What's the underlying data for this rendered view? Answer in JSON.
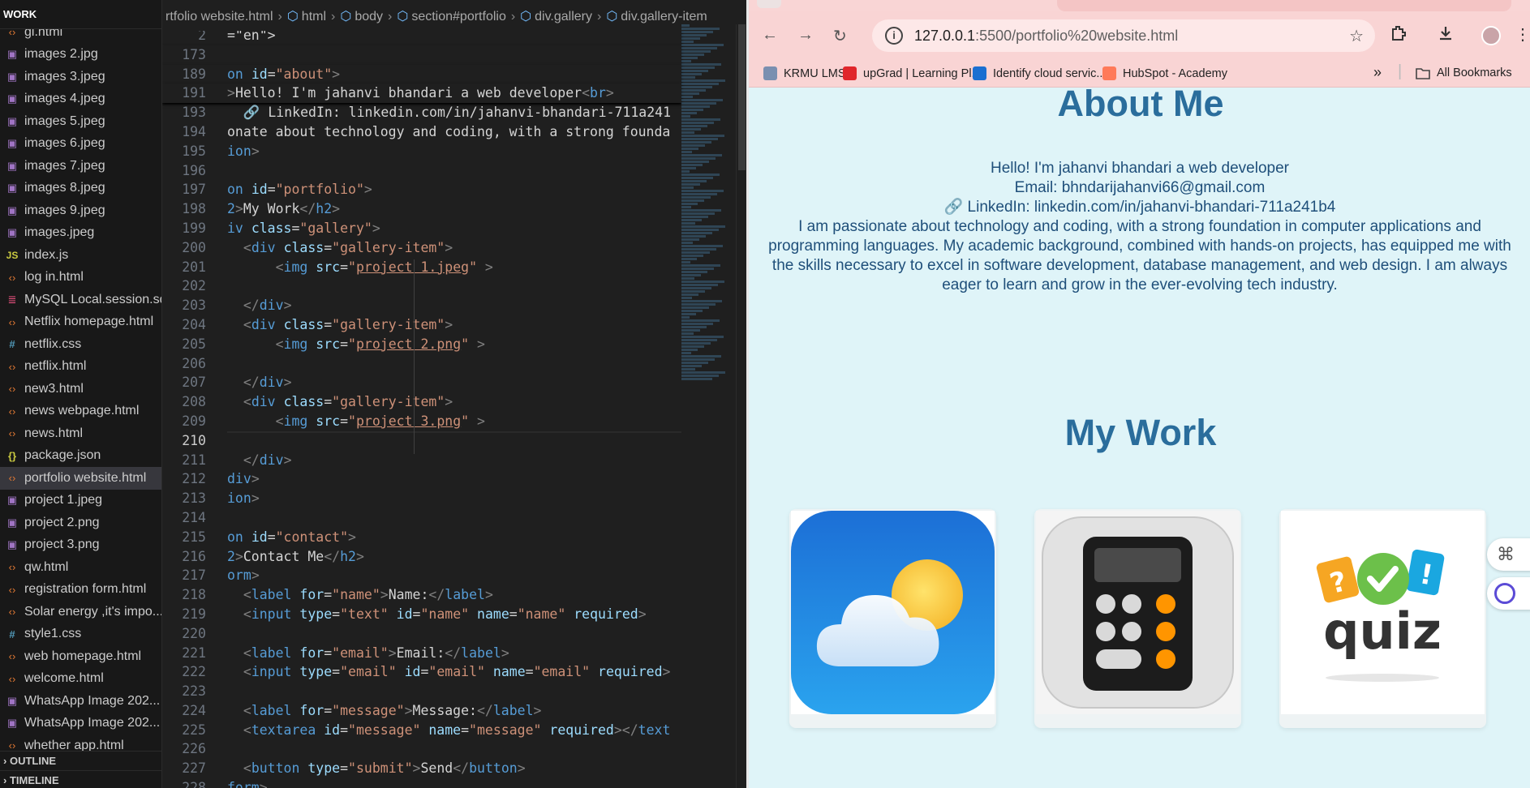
{
  "explorer": {
    "header": "WORK",
    "items": [
      {
        "name": "gi.html",
        "type": "html"
      },
      {
        "name": "images 2.jpg",
        "type": "img"
      },
      {
        "name": "images 3.jpeg",
        "type": "img"
      },
      {
        "name": "images 4.jpeg",
        "type": "img"
      },
      {
        "name": "images 5.jpeg",
        "type": "img"
      },
      {
        "name": "images 6.jpeg",
        "type": "img"
      },
      {
        "name": "images 7.jpeg",
        "type": "img"
      },
      {
        "name": "images 8.jpeg",
        "type": "img"
      },
      {
        "name": "images 9.jpeg",
        "type": "img"
      },
      {
        "name": "images.jpeg",
        "type": "img"
      },
      {
        "name": "index.js",
        "type": "js"
      },
      {
        "name": "log in.html",
        "type": "html"
      },
      {
        "name": "MySQL Local.session.sql",
        "type": "sql"
      },
      {
        "name": "Netflix homepage.html",
        "type": "html"
      },
      {
        "name": "netflix.css",
        "type": "css"
      },
      {
        "name": "netflix.html",
        "type": "html"
      },
      {
        "name": "new3.html",
        "type": "html"
      },
      {
        "name": "news webpage.html",
        "type": "html"
      },
      {
        "name": "news.html",
        "type": "html"
      },
      {
        "name": "package.json",
        "type": "json"
      },
      {
        "name": "portfolio website.html",
        "type": "html",
        "active": true
      },
      {
        "name": "project 1.jpeg",
        "type": "img"
      },
      {
        "name": "project 2.png",
        "type": "img"
      },
      {
        "name": "project 3.png",
        "type": "img"
      },
      {
        "name": "qw.html",
        "type": "html"
      },
      {
        "name": "registration form.html",
        "type": "html"
      },
      {
        "name": "Solar energy ,it's impo...",
        "type": "html"
      },
      {
        "name": "style1.css",
        "type": "css"
      },
      {
        "name": "web homepage.html",
        "type": "html"
      },
      {
        "name": "welcome.html",
        "type": "html"
      },
      {
        "name": "WhatsApp Image 202...",
        "type": "img"
      },
      {
        "name": "WhatsApp Image 202...",
        "type": "img"
      },
      {
        "name": "whether app.html",
        "type": "html"
      }
    ],
    "outline": "OUTLINE",
    "timeline": "TIMELINE"
  },
  "editor": {
    "breadcrumbs": [
      "rtfolio website.html",
      "html",
      "body",
      "section#portfolio",
      "div.gallery",
      "div.gallery-item"
    ],
    "current_line": "210",
    "lines": [
      {
        "n": "2",
        "sticky": true,
        "tokens": [
          [
            "t-txt",
            "=\"en\">"
          ]
        ]
      },
      {
        "n": "173",
        "sticky": true,
        "tokens": []
      },
      {
        "n": "189",
        "sticky": true,
        "tokens": [
          [
            "t-tag",
            "on "
          ],
          [
            "t-attr",
            "id"
          ],
          [
            "t-txt",
            "="
          ],
          [
            "t-str",
            "\"about\""
          ],
          [
            "t-p",
            ">"
          ]
        ]
      },
      {
        "n": "191",
        "sticky": true,
        "tokens": [
          [
            "t-p",
            ">"
          ],
          [
            "t-txt",
            "Hello! I'm jahanvi bhandari a web developer"
          ],
          [
            "t-p",
            "<"
          ],
          [
            "t-tag",
            "br"
          ],
          [
            "t-p",
            ">"
          ]
        ]
      },
      {
        "n": "193",
        "tokens": [
          [
            "t-txt",
            "  🔗 LinkedIn: linkedin.com/in/jahanvi-bhandari-711a241"
          ]
        ]
      },
      {
        "n": "194",
        "tokens": [
          [
            "t-txt",
            "onate about technology and coding, with a strong founda"
          ]
        ]
      },
      {
        "n": "195",
        "tokens": [
          [
            "t-tag",
            "ion"
          ],
          [
            "t-p",
            ">"
          ]
        ]
      },
      {
        "n": "196",
        "tokens": []
      },
      {
        "n": "197",
        "tokens": [
          [
            "t-tag",
            "on "
          ],
          [
            "t-attr",
            "id"
          ],
          [
            "t-txt",
            "="
          ],
          [
            "t-str",
            "\"portfolio\""
          ],
          [
            "t-p",
            ">"
          ]
        ]
      },
      {
        "n": "198",
        "tokens": [
          [
            "t-tag",
            "2"
          ],
          [
            "t-p",
            ">"
          ],
          [
            "t-txt",
            "My Work"
          ],
          [
            "t-p",
            "</"
          ],
          [
            "t-tag",
            "h2"
          ],
          [
            "t-p",
            ">"
          ]
        ]
      },
      {
        "n": "199",
        "tokens": [
          [
            "t-tag",
            "iv "
          ],
          [
            "t-attr",
            "class"
          ],
          [
            "t-txt",
            "="
          ],
          [
            "t-str",
            "\"gallery\""
          ],
          [
            "t-p",
            ">"
          ]
        ]
      },
      {
        "n": "200",
        "tokens": [
          [
            "t-txt",
            "  "
          ],
          [
            "t-p",
            "<"
          ],
          [
            "t-tag",
            "div "
          ],
          [
            "t-attr",
            "class"
          ],
          [
            "t-txt",
            "="
          ],
          [
            "t-str",
            "\"gallery-item\""
          ],
          [
            "t-p",
            ">"
          ]
        ]
      },
      {
        "n": "201",
        "tokens": [
          [
            "t-txt",
            "      "
          ],
          [
            "t-p",
            "<"
          ],
          [
            "t-tag",
            "img "
          ],
          [
            "t-attr",
            "src"
          ],
          [
            "t-txt",
            "="
          ],
          [
            "t-str",
            "\""
          ],
          [
            "t-str t-link",
            "project 1.jpeg"
          ],
          [
            "t-str",
            "\""
          ],
          [
            "t-p",
            " >"
          ]
        ]
      },
      {
        "n": "202",
        "tokens": []
      },
      {
        "n": "203",
        "tokens": [
          [
            "t-txt",
            "  "
          ],
          [
            "t-p",
            "</"
          ],
          [
            "t-tag",
            "div"
          ],
          [
            "t-p",
            ">"
          ]
        ]
      },
      {
        "n": "204",
        "tokens": [
          [
            "t-txt",
            "  "
          ],
          [
            "t-p",
            "<"
          ],
          [
            "t-tag",
            "div "
          ],
          [
            "t-attr",
            "class"
          ],
          [
            "t-txt",
            "="
          ],
          [
            "t-str",
            "\"gallery-item\""
          ],
          [
            "t-p",
            ">"
          ]
        ]
      },
      {
        "n": "205",
        "tokens": [
          [
            "t-txt",
            "      "
          ],
          [
            "t-p",
            "<"
          ],
          [
            "t-tag",
            "img "
          ],
          [
            "t-attr",
            "src"
          ],
          [
            "t-txt",
            "="
          ],
          [
            "t-str",
            "\""
          ],
          [
            "t-str t-link",
            "project 2.png"
          ],
          [
            "t-str",
            "\""
          ],
          [
            "t-p",
            " >"
          ]
        ]
      },
      {
        "n": "206",
        "tokens": []
      },
      {
        "n": "207",
        "tokens": [
          [
            "t-txt",
            "  "
          ],
          [
            "t-p",
            "</"
          ],
          [
            "t-tag",
            "div"
          ],
          [
            "t-p",
            ">"
          ]
        ]
      },
      {
        "n": "208",
        "tokens": [
          [
            "t-txt",
            "  "
          ],
          [
            "t-p",
            "<"
          ],
          [
            "t-tag",
            "div "
          ],
          [
            "t-attr",
            "class"
          ],
          [
            "t-txt",
            "="
          ],
          [
            "t-str",
            "\"gallery-item\""
          ],
          [
            "t-p",
            ">"
          ]
        ]
      },
      {
        "n": "209",
        "tokens": [
          [
            "t-txt",
            "      "
          ],
          [
            "t-p",
            "<"
          ],
          [
            "t-tag",
            "img "
          ],
          [
            "t-attr",
            "src"
          ],
          [
            "t-txt",
            "="
          ],
          [
            "t-str",
            "\""
          ],
          [
            "t-str t-link",
            "project 3.png"
          ],
          [
            "t-str",
            "\""
          ],
          [
            "t-p",
            " >"
          ]
        ]
      },
      {
        "n": "210",
        "tokens": []
      },
      {
        "n": "211",
        "tokens": [
          [
            "t-txt",
            "  "
          ],
          [
            "t-p",
            "</"
          ],
          [
            "t-tag",
            "div"
          ],
          [
            "t-p",
            ">"
          ]
        ]
      },
      {
        "n": "212",
        "tokens": [
          [
            "t-tag",
            "div"
          ],
          [
            "t-p",
            ">"
          ]
        ]
      },
      {
        "n": "213",
        "tokens": [
          [
            "t-tag",
            "ion"
          ],
          [
            "t-p",
            ">"
          ]
        ]
      },
      {
        "n": "214",
        "tokens": []
      },
      {
        "n": "215",
        "tokens": [
          [
            "t-tag",
            "on "
          ],
          [
            "t-attr",
            "id"
          ],
          [
            "t-txt",
            "="
          ],
          [
            "t-str",
            "\"contact\""
          ],
          [
            "t-p",
            ">"
          ]
        ]
      },
      {
        "n": "216",
        "tokens": [
          [
            "t-tag",
            "2"
          ],
          [
            "t-p",
            ">"
          ],
          [
            "t-txt",
            "Contact Me"
          ],
          [
            "t-p",
            "</"
          ],
          [
            "t-tag",
            "h2"
          ],
          [
            "t-p",
            ">"
          ]
        ]
      },
      {
        "n": "217",
        "tokens": [
          [
            "t-tag",
            "orm"
          ],
          [
            "t-p",
            ">"
          ]
        ]
      },
      {
        "n": "218",
        "tokens": [
          [
            "t-txt",
            "  "
          ],
          [
            "t-p",
            "<"
          ],
          [
            "t-tag",
            "label "
          ],
          [
            "t-attr",
            "for"
          ],
          [
            "t-txt",
            "="
          ],
          [
            "t-str",
            "\"name\""
          ],
          [
            "t-p",
            ">"
          ],
          [
            "t-txt",
            "Name:"
          ],
          [
            "t-p",
            "</"
          ],
          [
            "t-tag",
            "label"
          ],
          [
            "t-p",
            ">"
          ]
        ]
      },
      {
        "n": "219",
        "tokens": [
          [
            "t-txt",
            "  "
          ],
          [
            "t-p",
            "<"
          ],
          [
            "t-tag",
            "input "
          ],
          [
            "t-attr",
            "type"
          ],
          [
            "t-txt",
            "="
          ],
          [
            "t-str",
            "\"text\""
          ],
          [
            "t-attr",
            " id"
          ],
          [
            "t-txt",
            "="
          ],
          [
            "t-str",
            "\"name\""
          ],
          [
            "t-attr",
            " name"
          ],
          [
            "t-txt",
            "="
          ],
          [
            "t-str",
            "\"name\""
          ],
          [
            "t-attr",
            " required"
          ],
          [
            "t-p",
            ">"
          ]
        ]
      },
      {
        "n": "220",
        "tokens": []
      },
      {
        "n": "221",
        "tokens": [
          [
            "t-txt",
            "  "
          ],
          [
            "t-p",
            "<"
          ],
          [
            "t-tag",
            "label "
          ],
          [
            "t-attr",
            "for"
          ],
          [
            "t-txt",
            "="
          ],
          [
            "t-str",
            "\"email\""
          ],
          [
            "t-p",
            ">"
          ],
          [
            "t-txt",
            "Email:"
          ],
          [
            "t-p",
            "</"
          ],
          [
            "t-tag",
            "label"
          ],
          [
            "t-p",
            ">"
          ]
        ]
      },
      {
        "n": "222",
        "tokens": [
          [
            "t-txt",
            "  "
          ],
          [
            "t-p",
            "<"
          ],
          [
            "t-tag",
            "input "
          ],
          [
            "t-attr",
            "type"
          ],
          [
            "t-txt",
            "="
          ],
          [
            "t-str",
            "\"email\""
          ],
          [
            "t-attr",
            " id"
          ],
          [
            "t-txt",
            "="
          ],
          [
            "t-str",
            "\"email\""
          ],
          [
            "t-attr",
            " name"
          ],
          [
            "t-txt",
            "="
          ],
          [
            "t-str",
            "\"email\""
          ],
          [
            "t-attr",
            " required"
          ],
          [
            "t-p",
            ">"
          ]
        ]
      },
      {
        "n": "223",
        "tokens": []
      },
      {
        "n": "224",
        "tokens": [
          [
            "t-txt",
            "  "
          ],
          [
            "t-p",
            "<"
          ],
          [
            "t-tag",
            "label "
          ],
          [
            "t-attr",
            "for"
          ],
          [
            "t-txt",
            "="
          ],
          [
            "t-str",
            "\"message\""
          ],
          [
            "t-p",
            ">"
          ],
          [
            "t-txt",
            "Message:"
          ],
          [
            "t-p",
            "</"
          ],
          [
            "t-tag",
            "label"
          ],
          [
            "t-p",
            ">"
          ]
        ]
      },
      {
        "n": "225",
        "tokens": [
          [
            "t-txt",
            "  "
          ],
          [
            "t-p",
            "<"
          ],
          [
            "t-tag",
            "textarea "
          ],
          [
            "t-attr",
            "id"
          ],
          [
            "t-txt",
            "="
          ],
          [
            "t-str",
            "\"message\""
          ],
          [
            "t-attr",
            " name"
          ],
          [
            "t-txt",
            "="
          ],
          [
            "t-str",
            "\"message\""
          ],
          [
            "t-attr",
            " required"
          ],
          [
            "t-p",
            "></"
          ],
          [
            "t-tag",
            "text"
          ]
        ]
      },
      {
        "n": "226",
        "tokens": []
      },
      {
        "n": "227",
        "tokens": [
          [
            "t-txt",
            "  "
          ],
          [
            "t-p",
            "<"
          ],
          [
            "t-tag",
            "button "
          ],
          [
            "t-attr",
            "type"
          ],
          [
            "t-txt",
            "="
          ],
          [
            "t-str",
            "\"submit\""
          ],
          [
            "t-p",
            ">"
          ],
          [
            "t-txt",
            "Send"
          ],
          [
            "t-p",
            "</"
          ],
          [
            "t-tag",
            "button"
          ],
          [
            "t-p",
            ">"
          ]
        ]
      },
      {
        "n": "228",
        "tokens": [
          [
            "t-tag",
            "form"
          ],
          [
            "t-p",
            ">"
          ]
        ]
      }
    ]
  },
  "browser": {
    "url_host": "127.0.0.1",
    "url_path": ":5500/portfolio%20website.html",
    "bookmarks": [
      {
        "label": "KRMU LMS",
        "color": "#7a8fb0"
      },
      {
        "label": "upGrad | Learning Pl...",
        "color": "#e0262b"
      },
      {
        "label": "Identify cloud servic...",
        "color": "#1a6fd1"
      },
      {
        "label": "HubSpot - Academy",
        "color": "#ff7a59"
      }
    ],
    "all_bookmarks": "All Bookmarks",
    "page": {
      "about_title": "About Me",
      "about_lines": [
        "Hello! I'm jahanvi bhandari a web developer",
        "Email: bhndarijahanvi66@gmail.com",
        "🔗 LinkedIn: linkedin.com/in/jahanvi-bhandari-711a241b4",
        "I am passionate about technology and coding, with a strong foundation in computer applications and programming languages. My academic background, combined with hands-on projects, has equipped me with the skills necessary to excel in software development, database management, and web design. I am always eager to learn and grow in the ever-evolving tech industry."
      ],
      "work_title": "My Work",
      "gallery": [
        "weather",
        "calculator",
        "quiz"
      ],
      "quiz_text": "quiz"
    }
  },
  "colors": {
    "page_bg": "#dff4f8",
    "heading": "#2a6d9c",
    "browser_chrome": "#f9d4d4"
  }
}
